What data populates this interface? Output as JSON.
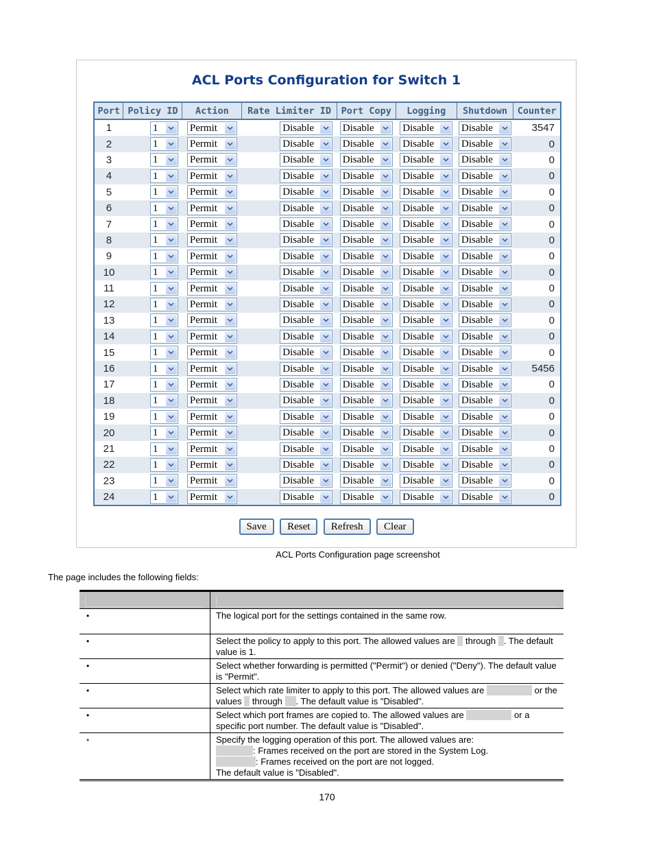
{
  "screenshot": {
    "title": "ACL Ports Configuration for Switch 1",
    "columns": [
      "Port",
      "Policy ID",
      "Action",
      "Rate Limiter ID",
      "Port Copy",
      "Logging",
      "Shutdown",
      "Counter"
    ],
    "rows": [
      {
        "port": "1",
        "policy_id": "1",
        "action": "Permit",
        "rate_limiter": "Disable",
        "port_copy": "Disable",
        "logging": "Disable",
        "shutdown": "Disable",
        "counter": "3547"
      },
      {
        "port": "2",
        "policy_id": "1",
        "action": "Permit",
        "rate_limiter": "Disable",
        "port_copy": "Disable",
        "logging": "Disable",
        "shutdown": "Disable",
        "counter": "0"
      },
      {
        "port": "3",
        "policy_id": "1",
        "action": "Permit",
        "rate_limiter": "Disable",
        "port_copy": "Disable",
        "logging": "Disable",
        "shutdown": "Disable",
        "counter": "0"
      },
      {
        "port": "4",
        "policy_id": "1",
        "action": "Permit",
        "rate_limiter": "Disable",
        "port_copy": "Disable",
        "logging": "Disable",
        "shutdown": "Disable",
        "counter": "0"
      },
      {
        "port": "5",
        "policy_id": "1",
        "action": "Permit",
        "rate_limiter": "Disable",
        "port_copy": "Disable",
        "logging": "Disable",
        "shutdown": "Disable",
        "counter": "0"
      },
      {
        "port": "6",
        "policy_id": "1",
        "action": "Permit",
        "rate_limiter": "Disable",
        "port_copy": "Disable",
        "logging": "Disable",
        "shutdown": "Disable",
        "counter": "0"
      },
      {
        "port": "7",
        "policy_id": "1",
        "action": "Permit",
        "rate_limiter": "Disable",
        "port_copy": "Disable",
        "logging": "Disable",
        "shutdown": "Disable",
        "counter": "0"
      },
      {
        "port": "8",
        "policy_id": "1",
        "action": "Permit",
        "rate_limiter": "Disable",
        "port_copy": "Disable",
        "logging": "Disable",
        "shutdown": "Disable",
        "counter": "0"
      },
      {
        "port": "9",
        "policy_id": "1",
        "action": "Permit",
        "rate_limiter": "Disable",
        "port_copy": "Disable",
        "logging": "Disable",
        "shutdown": "Disable",
        "counter": "0"
      },
      {
        "port": "10",
        "policy_id": "1",
        "action": "Permit",
        "rate_limiter": "Disable",
        "port_copy": "Disable",
        "logging": "Disable",
        "shutdown": "Disable",
        "counter": "0"
      },
      {
        "port": "11",
        "policy_id": "1",
        "action": "Permit",
        "rate_limiter": "Disable",
        "port_copy": "Disable",
        "logging": "Disable",
        "shutdown": "Disable",
        "counter": "0"
      },
      {
        "port": "12",
        "policy_id": "1",
        "action": "Permit",
        "rate_limiter": "Disable",
        "port_copy": "Disable",
        "logging": "Disable",
        "shutdown": "Disable",
        "counter": "0"
      },
      {
        "port": "13",
        "policy_id": "1",
        "action": "Permit",
        "rate_limiter": "Disable",
        "port_copy": "Disable",
        "logging": "Disable",
        "shutdown": "Disable",
        "counter": "0"
      },
      {
        "port": "14",
        "policy_id": "1",
        "action": "Permit",
        "rate_limiter": "Disable",
        "port_copy": "Disable",
        "logging": "Disable",
        "shutdown": "Disable",
        "counter": "0"
      },
      {
        "port": "15",
        "policy_id": "1",
        "action": "Permit",
        "rate_limiter": "Disable",
        "port_copy": "Disable",
        "logging": "Disable",
        "shutdown": "Disable",
        "counter": "0"
      },
      {
        "port": "16",
        "policy_id": "1",
        "action": "Permit",
        "rate_limiter": "Disable",
        "port_copy": "Disable",
        "logging": "Disable",
        "shutdown": "Disable",
        "counter": "5456"
      },
      {
        "port": "17",
        "policy_id": "1",
        "action": "Permit",
        "rate_limiter": "Disable",
        "port_copy": "Disable",
        "logging": "Disable",
        "shutdown": "Disable",
        "counter": "0"
      },
      {
        "port": "18",
        "policy_id": "1",
        "action": "Permit",
        "rate_limiter": "Disable",
        "port_copy": "Disable",
        "logging": "Disable",
        "shutdown": "Disable",
        "counter": "0"
      },
      {
        "port": "19",
        "policy_id": "1",
        "action": "Permit",
        "rate_limiter": "Disable",
        "port_copy": "Disable",
        "logging": "Disable",
        "shutdown": "Disable",
        "counter": "0"
      },
      {
        "port": "20",
        "policy_id": "1",
        "action": "Permit",
        "rate_limiter": "Disable",
        "port_copy": "Disable",
        "logging": "Disable",
        "shutdown": "Disable",
        "counter": "0"
      },
      {
        "port": "21",
        "policy_id": "1",
        "action": "Permit",
        "rate_limiter": "Disable",
        "port_copy": "Disable",
        "logging": "Disable",
        "shutdown": "Disable",
        "counter": "0"
      },
      {
        "port": "22",
        "policy_id": "1",
        "action": "Permit",
        "rate_limiter": "Disable",
        "port_copy": "Disable",
        "logging": "Disable",
        "shutdown": "Disable",
        "counter": "0"
      },
      {
        "port": "23",
        "policy_id": "1",
        "action": "Permit",
        "rate_limiter": "Disable",
        "port_copy": "Disable",
        "logging": "Disable",
        "shutdown": "Disable",
        "counter": "0"
      },
      {
        "port": "24",
        "policy_id": "1",
        "action": "Permit",
        "rate_limiter": "Disable",
        "port_copy": "Disable",
        "logging": "Disable",
        "shutdown": "Disable",
        "counter": "0"
      }
    ],
    "buttons": {
      "save": "Save",
      "reset": "Reset",
      "refresh": "Refresh",
      "clear": "Clear"
    },
    "dropdown_icon": "chevron-down-icon"
  },
  "caption": "ACL Ports Configuration page screenshot",
  "intro": "The page includes the following fields:",
  "fields": [
    {
      "bullet": "•",
      "desc_lines": [
        "The logical port for the settings contained in the same row."
      ]
    },
    {
      "bullet": "•",
      "desc_parts": [
        "Select the policy to apply to this port. The allowed values are ",
        " through ",
        ". The default value is 1."
      ]
    },
    {
      "bullet": "•",
      "desc_lines": [
        "Select whether forwarding is permitted (\"Permit\") or denied (\"Deny\"). The default value is \"Permit\"."
      ]
    },
    {
      "bullet": "•",
      "desc_parts": [
        "Select which rate limiter to apply to this port. The allowed values are ",
        " or the values ",
        " through ",
        ". The default value is \"Disabled\"."
      ]
    },
    {
      "bullet": "•",
      "desc_parts": [
        "Select which port frames are copied to. The allowed values are ",
        " or a specific port number. The default value is \"Disabled\"."
      ]
    },
    {
      "bullet": "•",
      "desc_parts": [
        "Specify the logging operation of this port. The allowed values are:",
        ": Frames received on the port are stored in the System Log.",
        ": Frames received on the port are not logged.",
        "The default value is \"Disabled\"."
      ]
    }
  ],
  "page_number": "170"
}
